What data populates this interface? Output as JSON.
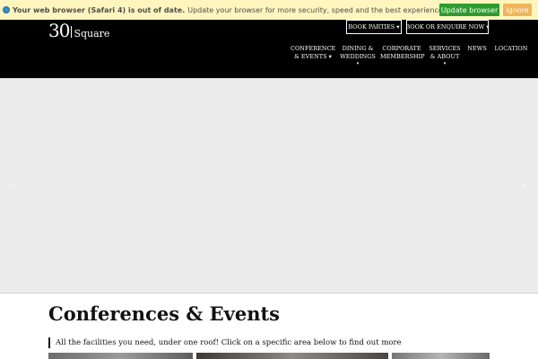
{
  "update_bar": {
    "headline": "Your web browser (Safari 4) is out of date.",
    "message": "Update your browser for more security, speed and the best experience on this site.",
    "update_label": "Update browser",
    "ignore_label": "Ignore"
  },
  "brand": {
    "number": "30",
    "word": "Square"
  },
  "header_buttons": {
    "book_parties": "BOOK PARTIES ▾",
    "book_enquire": "BOOK OR ENQUIRE NOW ▾"
  },
  "nav": {
    "conference": [
      "CONFERENCE",
      "& EVENTS ▾"
    ],
    "dining": [
      "DINING &",
      "WEDDINGS",
      "▾"
    ],
    "corporate": [
      "CORPORATE",
      "MEMBERSHIP"
    ],
    "services": [
      "SERVICES",
      "& ABOUT",
      "▾"
    ],
    "news": "NEWS",
    "location": "LOCATION"
  },
  "hero": {
    "prev_icon": "chevron-left-icon",
    "next_icon": "chevron-right-icon",
    "prev_glyph": "‹",
    "next_glyph": "›"
  },
  "content": {
    "title": "Conferences & Events",
    "subtitle": "All the facilities you need, under one roof! Click on a specific area below to find out more"
  },
  "colors": {
    "update_bar_bg": "#fff6bf",
    "update_button": "#2e9b2e",
    "ignore_button": "#f0b45a",
    "header_bg": "#000000",
    "hero_bg": "#ececec"
  }
}
